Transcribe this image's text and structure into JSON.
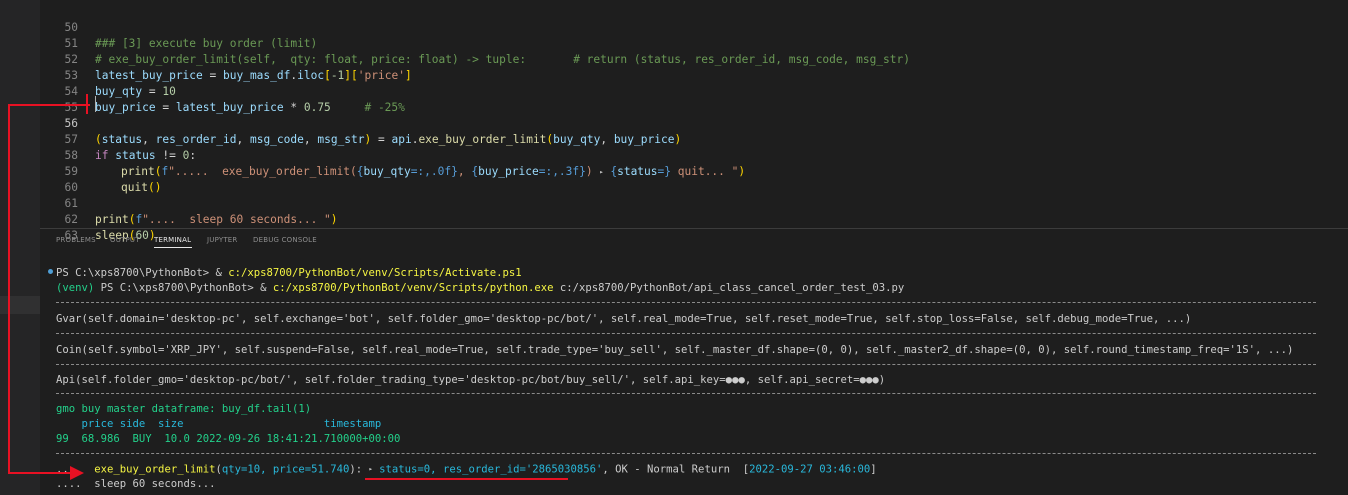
{
  "editor": {
    "lines": [
      {
        "n": "50",
        "key": "l50"
      },
      {
        "n": "51",
        "key": "l51"
      },
      {
        "n": "52",
        "key": "l52"
      },
      {
        "n": "53",
        "key": "l53"
      },
      {
        "n": "54",
        "key": "l54"
      },
      {
        "n": "55",
        "key": "l55"
      },
      {
        "n": "56",
        "key": "l56"
      },
      {
        "n": "57",
        "key": "l57"
      },
      {
        "n": "58",
        "key": "l58"
      },
      {
        "n": "59",
        "key": "l59"
      },
      {
        "n": "60",
        "key": "l60"
      },
      {
        "n": "61",
        "key": "l61"
      },
      {
        "n": "62",
        "key": "l62"
      },
      {
        "n": "63",
        "key": "l63"
      }
    ],
    "code": {
      "l50": "### [3] execute buy order (limit)",
      "l51": "# exe_buy_order_limit(self,  qty: float, price: float) -> tuple:       # return (status, res_order_id, msg_code, msg_str)",
      "l52_a": "latest_buy_price",
      "l52_b": " = ",
      "l52_c": "buy_mas_df",
      "l52_d": ".",
      "l52_e": "iloc",
      "l52_f": "[",
      "l52_g": "-1",
      "l52_h": "][",
      "l52_i": "'price'",
      "l52_j": "]",
      "l53_a": "buy_qty",
      "l53_b": " = ",
      "l53_c": "10",
      "l54_a": "buy_price",
      "l54_b": " = ",
      "l54_c": "latest_buy_price",
      "l54_d": " * ",
      "l54_e": "0.75",
      "l54_f": "     # -25%",
      "l56_a": "(",
      "l56_b": "status",
      "l56_c": ", ",
      "l56_d": "res_order_id",
      "l56_e": ", ",
      "l56_f": "msg_code",
      "l56_g": ", ",
      "l56_h": "msg_str",
      "l56_i": ")",
      "l56_j": " = ",
      "l56_k": "api",
      "l56_l": ".",
      "l56_m": "exe_buy_order_limit",
      "l56_n": "(",
      "l56_o": "buy_qty",
      "l56_p": ", ",
      "l56_q": "buy_price",
      "l56_r": ")",
      "l57_a": "if",
      "l57_b": " status",
      "l57_c": " != ",
      "l57_d": "0",
      "l57_e": ":",
      "l58_a": "print",
      "l58_b": "(",
      "l58_c": "f",
      "l58_d": "\".....  exe_buy_order_limit(",
      "l58_e": "{",
      "l58_f": "buy_qty",
      "l58_g": "=:,.0f",
      "l58_h": "}",
      "l58_i": ", ",
      "l58_j": "{",
      "l58_k": "buy_price",
      "l58_l": "=:,.3f",
      "l58_m": "}",
      "l58_n": ") ",
      "l58_o": "▸",
      "l58_p": " ",
      "l58_q": "{",
      "l58_r": "status",
      "l58_s": "=",
      "l58_t": "}",
      "l58_u": " quit... \"",
      "l58_v": ")",
      "l59_a": "quit",
      "l59_b": "()",
      "l61_a": "print",
      "l61_b": "(",
      "l61_c": "f",
      "l61_d": "\"....  sleep 60 seconds... \"",
      "l61_e": ")",
      "l62_a": "sleep",
      "l62_b": "(",
      "l62_c": "60",
      "l62_d": ")"
    }
  },
  "panel": {
    "tabs": [
      "PROBLEMS",
      "OUTPUT",
      "TERMINAL",
      "JUPYTER",
      "DEBUG CONSOLE"
    ],
    "active_tab": "TERMINAL"
  },
  "terminal": {
    "t1_a": "PS C:\\xps8700\\PythonBot> & ",
    "t1_b": "c:/xps8700/PythonBot/venv/Scripts/Activate.ps1",
    "t2_a": "(venv) ",
    "t2_b": "PS C:\\xps8700\\PythonBot> & ",
    "t2_c": "c:/xps8700/PythonBot/venv/Scripts/python.exe",
    "t2_d": " c:/xps8700/PythonBot/api_class_cancel_order_test_03.py",
    "gvar": "Gvar(self.domain='desktop-pc', self.exchange='bot', self.folder_gmo='desktop-pc/bot/', self.real_mode=True, self.reset_mode=True, self.stop_loss=False, self.debug_mode=True, ...)",
    "coin": "Coin(self.symbol='XRP_JPY', self.suspend=False, self.real_mode=True, self.trade_type='buy_sell', self._master_df.shape=(0, 0), self._master2_df.shape=(0, 0), self.round_timestamp_freq='1S', ...)",
    "api": "Api(self.folder_gmo='desktop-pc/bot/', self.folder_trading_type='desktop-pc/bot/buy_sell/', self.api_key=●●●, self.api_secret=●●●)",
    "gmo_title": "gmo buy master dataframe: buy_df.tail(1)",
    "df_header": "    price side  size                      timestamp",
    "df_row": "99  68.986  BUY  10.0 2022-09-26 18:41:21.710000+00:00",
    "r_dots": "....  ",
    "r_fn": "exe_buy_order_limit",
    "r_open": "(",
    "r_args": "qty=10, price=51.740",
    "r_close": "): ",
    "r_tri": "▸",
    "r_status": " status=0, res_order_id='2865030856'",
    "r_ok": ", OK - Normal Return  ",
    "r_ts_open": "[",
    "r_ts": "2022-09-27 03:46:00",
    "r_ts_close": "]",
    "sleep": "....  sleep 60 seconds..."
  },
  "colors": {
    "annotation_red": "#e81123"
  }
}
